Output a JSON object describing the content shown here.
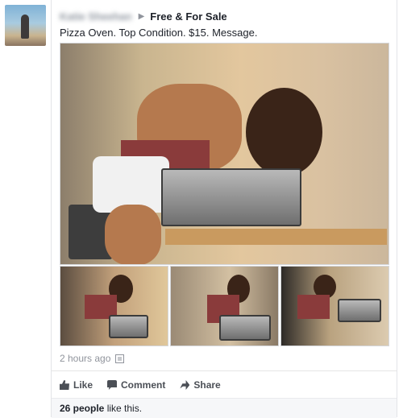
{
  "post": {
    "author": "Katie Sheehan",
    "group": "Free & For Sale",
    "message": "Pizza Oven. Top Condition. $15. Message.",
    "timestamp": "2 hours ago",
    "privacy_icon": "audience-icon"
  },
  "actions": {
    "like": "Like",
    "comment": "Comment",
    "share": "Share"
  },
  "likes": {
    "count": "26 people",
    "suffix": "like this."
  }
}
